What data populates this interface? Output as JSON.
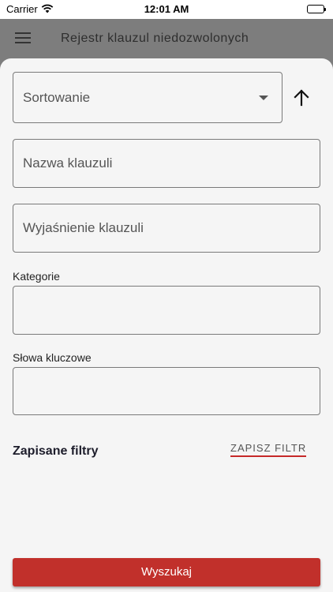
{
  "status_bar": {
    "carrier": "Carrier",
    "time": "12:01 AM"
  },
  "app_bar": {
    "title": "Rejestr klauzul niedozwolonych"
  },
  "form": {
    "sort_placeholder": "Sortowanie",
    "name_placeholder": "Nazwa klauzuli",
    "explanation_placeholder": "Wyjaśnienie klauzuli",
    "categories_label": "Kategorie",
    "keywords_label": "Słowa kluczowe",
    "saved_filters_label": "Zapisane filtry",
    "save_filter_label": "ZAPISZ FILTR",
    "search_label": "Wyszukaj"
  },
  "icons": {
    "menu": "hamburger-menu-icon",
    "sort": "arrow-up-icon",
    "dropdown": "caret-down-icon"
  },
  "colors": {
    "accent": "#c1302b",
    "overlay": "#7d7d7d",
    "sheet": "#f5f5f5"
  }
}
